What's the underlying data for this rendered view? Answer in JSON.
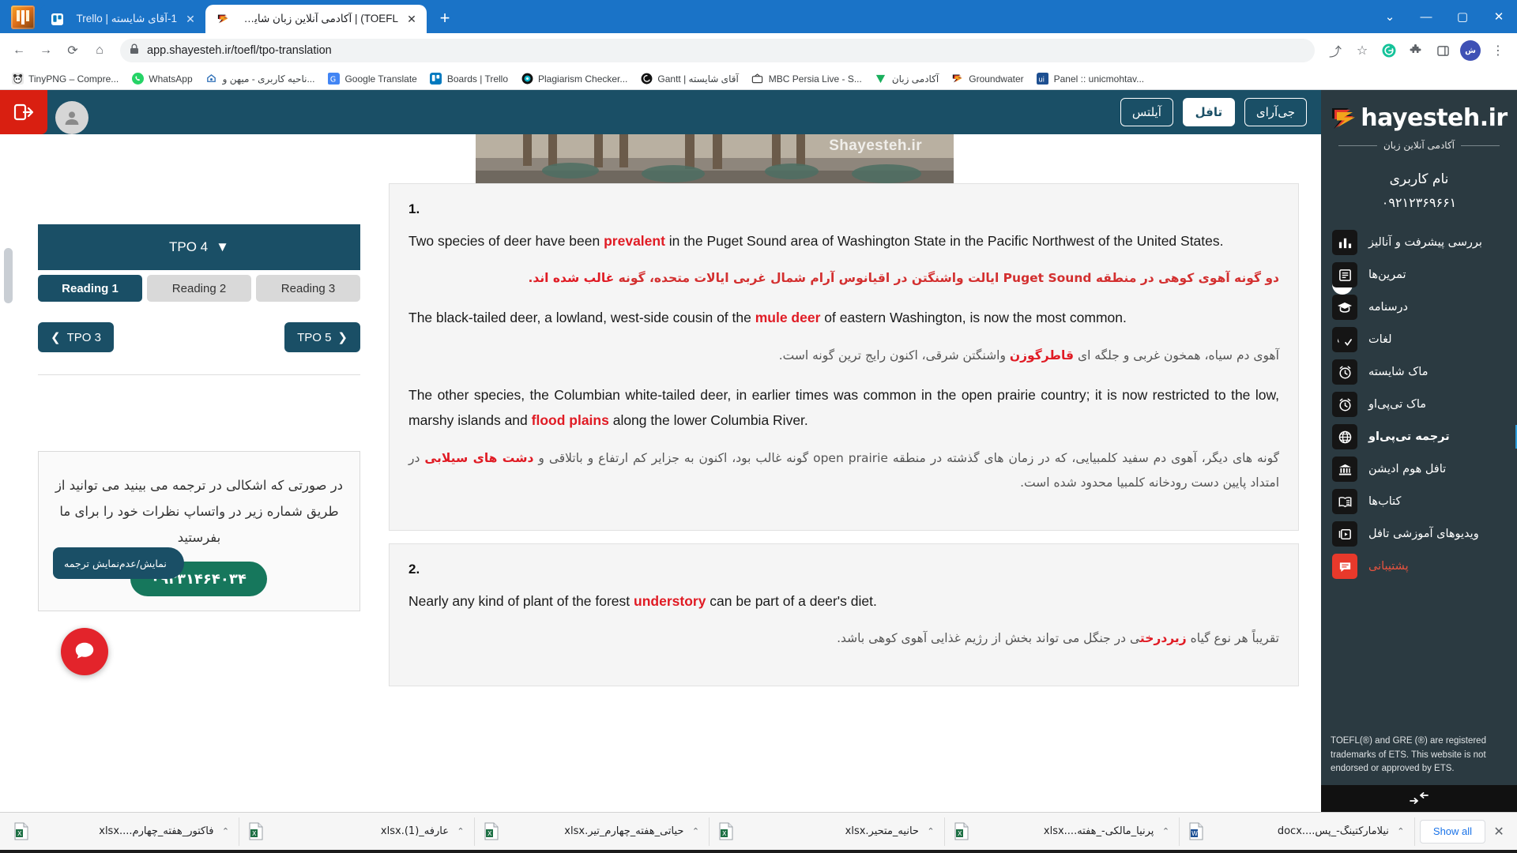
{
  "browser": {
    "tabs": [
      {
        "title": "1-آقای شایسته | Trello",
        "active": false,
        "favicon": "trello-icon"
      },
      {
        "title": "TOEFL) | آکادمی آنلاین زبان شایسته",
        "active": true,
        "favicon": "shayesteh-icon"
      }
    ],
    "new_tab_label": "+",
    "window_controls": {
      "minimize": "—",
      "maximize": "▢",
      "close": "✕",
      "chevron": "⌄"
    },
    "toolbar": {
      "back": "←",
      "forward": "→",
      "reload": "⟳",
      "home": "⌂",
      "url": "app.shayesteh.ir/toefl/tpo-translation",
      "lock_icon": "lock-icon",
      "share": "⤴",
      "bookmark_star": "☆",
      "profile_initials": "ش"
    },
    "bookmarks": [
      {
        "label": "TinyPNG – Compre...",
        "icon": "panda-icon"
      },
      {
        "label": "WhatsApp",
        "icon": "whatsapp-icon"
      },
      {
        "label": "ناحیه کاربری - میهن و...",
        "icon": "mihan-icon"
      },
      {
        "label": "Google Translate",
        "icon": "translate-icon"
      },
      {
        "label": "Boards | Trello",
        "icon": "trello-icon"
      },
      {
        "label": "Plagiarism Checker...",
        "icon": "plagiarism-icon"
      },
      {
        "label": "Gantt | آقای شایسته",
        "icon": "gantt-icon"
      },
      {
        "label": "MBC Persia Live - S...",
        "icon": "tv-icon"
      },
      {
        "label": "آکادمی زبان",
        "icon": "v-icon"
      },
      {
        "label": "Groundwater",
        "icon": "shayesteh-icon"
      },
      {
        "label": "Panel :: unicmohtav...",
        "icon": "panel-icon"
      }
    ]
  },
  "app": {
    "topbar_buttons": [
      {
        "label": "آیلتس",
        "active": false
      },
      {
        "label": "تافل",
        "active": true
      },
      {
        "label": "جی‌آرای",
        "active": false
      }
    ],
    "logout_icon": "logout-icon",
    "user_icon": "user-icon",
    "hero_watermark": "Shayesteh.ir"
  },
  "left_panel": {
    "tpo_selector": {
      "label": "TPO 4",
      "caret": "▼"
    },
    "reading_tabs": [
      {
        "label": "Reading 1",
        "active": true
      },
      {
        "label": "Reading 2",
        "active": false
      },
      {
        "label": "Reading 3",
        "active": false
      }
    ],
    "prev_button": {
      "label": "TPO 3",
      "arrow": "❮"
    },
    "next_button": {
      "label": "TPO 5",
      "arrow": "❯"
    },
    "note": {
      "text": "در صورتی که اشکالی در ترجمه می بینید می توانید از طریق شماره زیر در واتساپ نظرات خود را برای ما بفرستید",
      "phone": "۰۹۳۳۱۴۶۴۰۳۴",
      "toggle_label": "نمایش/عدم‌نمایش ترجمه"
    },
    "chat_fab_icon": "chat-bubble-icon"
  },
  "reading": {
    "blocks": [
      {
        "number": "1.",
        "paragraphs": [
          {
            "en_pre": "Two species of deer have been ",
            "en_hl": "prevalent",
            "en_post": " in the Puget Sound area of Washington State in the Pacific Northwest of the United States.",
            "fa_pre": "دو گونه آهوی کوهی در منطقه Puget Sound ایالت واشنگتن در اقیانوس آرام شمال غربی ایالات متحده، گونه ",
            "fa_hl": "غالب شده اند",
            "fa_post": ".",
            "fa_style": "red"
          },
          {
            "en_pre": "The black-tailed deer, a lowland, west-side cousin of the ",
            "en_hl": "mule deer",
            "en_post": " of eastern Washington, is now the most common.",
            "fa_pre": "آهوی دم سیاه، همخون غربی و جلگه ای ",
            "fa_hl": "قاطرگوزن",
            "fa_post": " واشنگتن شرقی، اکنون رایج ترین گونه است.",
            "fa_style": "gray"
          },
          {
            "en_pre": "The other species, the Columbian white-tailed deer, in earlier times was common in the open prairie country; it is now restricted to the low, marshy islands and ",
            "en_hl": "flood plains",
            "en_post": " along the lower Columbia River.",
            "fa_pre": "گونه های دیگر، آهوی دم سفید کلمبیایی، که در زمان های گذشته در منطقه open prairie گونه غالب بود، اکنون به جزایر کم ارتفاع و باتلاقی و ",
            "fa_hl": "دشت های سیلابی",
            "fa_post": " در امتداد پایین دست رودخانه  کلمبیا محدود شده است.",
            "fa_style": "gray"
          }
        ]
      },
      {
        "number": "2.",
        "paragraphs": [
          {
            "en_pre": "Nearly any kind of plant of the forest ",
            "en_hl": "understory",
            "en_post": " can be part of a deer's diet.",
            "fa_pre": "تقریباً هر نوع گیاه ",
            "fa_hl": "زیردرخت",
            "fa_post": "ی در جنگل می تواند بخش از رژیم غذایی آهوی کوهی باشد.",
            "fa_style": "gray"
          }
        ]
      }
    ]
  },
  "sidebar": {
    "logo_text": "hayesteh.ir",
    "logo_icon": "shayesteh-flag-icon",
    "tagline": "آکادمی آنلاین زبان",
    "user_label": "نام کاربری",
    "user_phone": "۰۹۲۱۲۳۶۹۶۶۱",
    "collapse_dot_icon": "chevron-down-icon",
    "items": [
      {
        "label": "بررسی پیشرفت و آنالیز",
        "icon": "bar-chart-icon",
        "current": false,
        "support": false
      },
      {
        "label": "تمرین‌ها",
        "icon": "exercises-icon",
        "current": false,
        "support": false
      },
      {
        "label": "درسنامه",
        "icon": "graduation-cap-icon",
        "current": false,
        "support": false
      },
      {
        "label": "لغات",
        "icon": "spellcheck-icon",
        "current": false,
        "support": false
      },
      {
        "label": "ماک شایسته",
        "icon": "alarm-clock-icon",
        "current": false,
        "support": false
      },
      {
        "label": "ماک تی‌پی‌او",
        "icon": "alarm-clock-icon",
        "current": false,
        "support": false
      },
      {
        "label": "ترجمه تی‌پی‌او",
        "icon": "globe-icon",
        "current": true,
        "support": false
      },
      {
        "label": "تافل هوم ادیشن",
        "icon": "bank-icon",
        "current": false,
        "support": false
      },
      {
        "label": "کتاب‌ها",
        "icon": "open-book-icon",
        "current": false,
        "support": false
      },
      {
        "label": "ویدیوهای آموزشی تافل",
        "icon": "video-play-icon",
        "current": false,
        "support": false
      },
      {
        "label": "پشتیبانی",
        "icon": "chat-support-icon",
        "current": false,
        "support": true
      }
    ],
    "disclaimer": "TOEFL(®) and GRE (®) are registered trademarks of ETS. This website is not endorsed or approved by ETS.",
    "collapse_bar_icon": "collapse-arrows-icon"
  },
  "downloads": {
    "items": [
      {
        "name": "فاکتور_هفته_چهارم....xlsx",
        "type": "xlsx"
      },
      {
        "name": "عارفه_(1).xlsx",
        "type": "xlsx"
      },
      {
        "name": "حیاتی_هفته_چهارم_تیر.xlsx",
        "type": "xlsx"
      },
      {
        "name": "حانیه_متحیر.xlsx",
        "type": "xlsx"
      },
      {
        "name": "پرنیا_مالکی-_هفته....xlsx",
        "type": "xlsx"
      },
      {
        "name": "نیلامارکتینگ-_پس....docx",
        "type": "docx"
      }
    ],
    "caret": "⌃",
    "show_all_label": "Show all",
    "close_label": "✕"
  },
  "colors": {
    "chrome_blue": "#1a73c7",
    "brand_teal": "#1a4f66",
    "sidebar_dark": "#2b3a41",
    "accent_red": "#e01b24",
    "green_pill": "#16775c",
    "support_red": "#e8533f"
  }
}
